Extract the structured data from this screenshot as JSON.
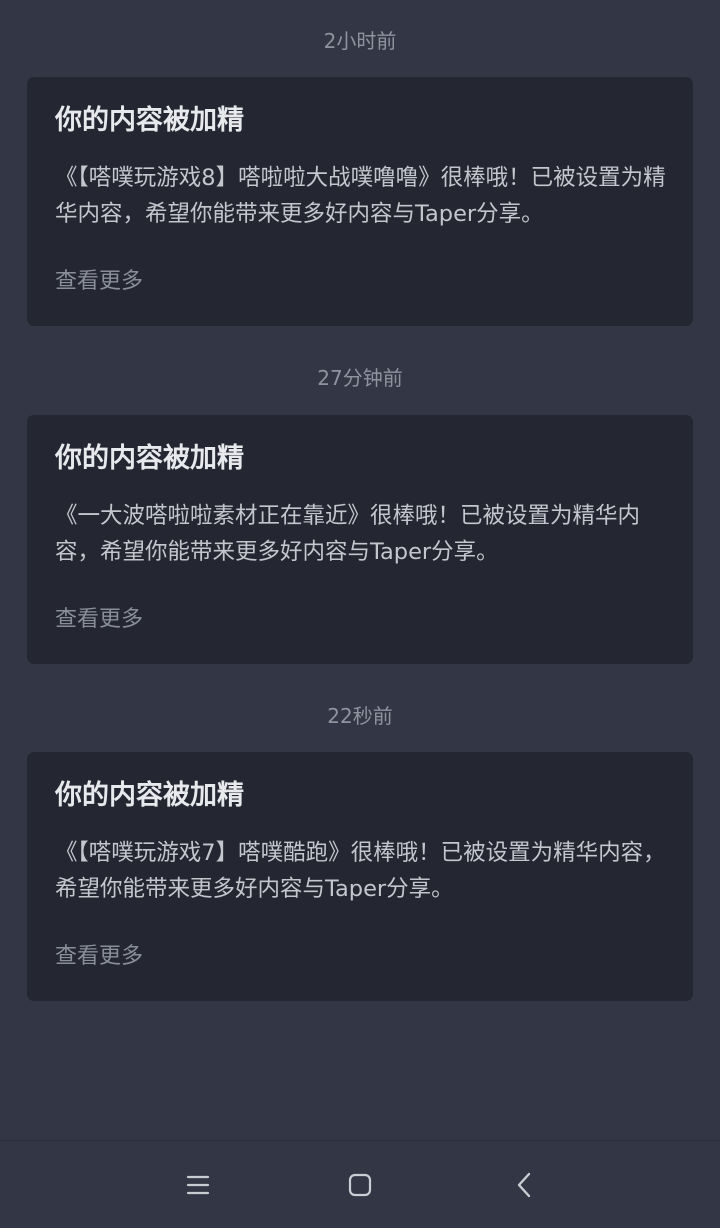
{
  "feed": [
    {
      "timestamp": "2小时前",
      "title": "你的内容被加精",
      "body": "《【嗒噗玩游戏8】嗒啦啦大战噗噜噜》很棒哦！已被设置为精华内容，希望你能带来更多好内容与Taper分享。",
      "more": "查看更多"
    },
    {
      "timestamp": "27分钟前",
      "title": "你的内容被加精",
      "body": "《一大波嗒啦啦素材正在靠近》很棒哦！已被设置为精华内容，希望你能带来更多好内容与Taper分享。",
      "more": "查看更多"
    },
    {
      "timestamp": "22秒前",
      "title": "你的内容被加精",
      "body": "《【嗒噗玩游戏7】嗒噗酷跑》很棒哦！已被设置为精华内容，希望你能带来更多好内容与Taper分享。",
      "more": "查看更多"
    }
  ],
  "navbar": {
    "buttons": [
      "menu-icon",
      "home-square-icon",
      "back-chevron-icon"
    ]
  },
  "colors": {
    "background": "#333745",
    "card": "#242631",
    "title": "#e8e9ec",
    "body": "#c3c6cd",
    "muted": "#8a8e99"
  }
}
